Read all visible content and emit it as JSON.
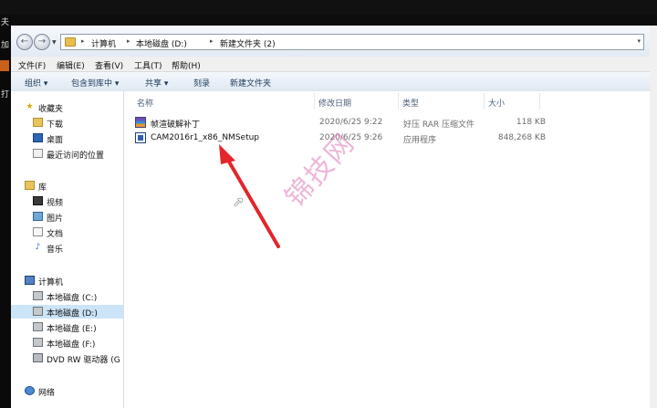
{
  "window": {
    "edge_chars": [
      "夫",
      "加",
      "打"
    ],
    "nav": {
      "back": "←",
      "forward": "→",
      "recent": "▼"
    },
    "address": {
      "crumbs": [
        "计算机",
        "本地磁盘 (D:)",
        "新建文件夹 (2)"
      ],
      "separator": "▸",
      "first_sep": "▸",
      "end_glyph": "▾"
    },
    "menu": [
      "文件(F)",
      "编辑(E)",
      "查看(V)",
      "工具(T)",
      "帮助(H)"
    ],
    "toolbar": [
      "组织 ▾",
      "包含到库中 ▾",
      "共享 ▾",
      "刻录",
      "新建文件夹"
    ]
  },
  "navpane": {
    "favorites": {
      "header": "收藏夹",
      "items": [
        "下载",
        "桌面",
        "最近访问的位置"
      ]
    },
    "libraries": {
      "header": "库",
      "items": [
        "视频",
        "图片",
        "文档",
        "音乐"
      ]
    },
    "computer": {
      "header": "计算机",
      "items": [
        "本地磁盘 (C:)",
        "本地磁盘 (D:)",
        "本地磁盘 (E:)",
        "本地磁盘 (F:)",
        "DVD RW 驱动器 (G"
      ],
      "selected_index": 1
    },
    "network": {
      "header": "网络"
    }
  },
  "columns": {
    "name": "名称",
    "modified": "修改日期",
    "type": "类型",
    "size": "大小"
  },
  "files": [
    {
      "name": "帧渲破解补丁",
      "modified": "2020/6/25 9:22",
      "type": "好压 RAR 压缩文件",
      "size": "118 KB",
      "icon": "rar-archive-icon"
    },
    {
      "name": "CAM2016r1_x86_NMSetup",
      "modified": "2020/6/25 9:26",
      "type": "应用程序",
      "size": "848,268 KB",
      "icon": "application-icon"
    }
  ],
  "overlay": {
    "watermark": "锦技网",
    "arrow_color": "#e3262b"
  }
}
